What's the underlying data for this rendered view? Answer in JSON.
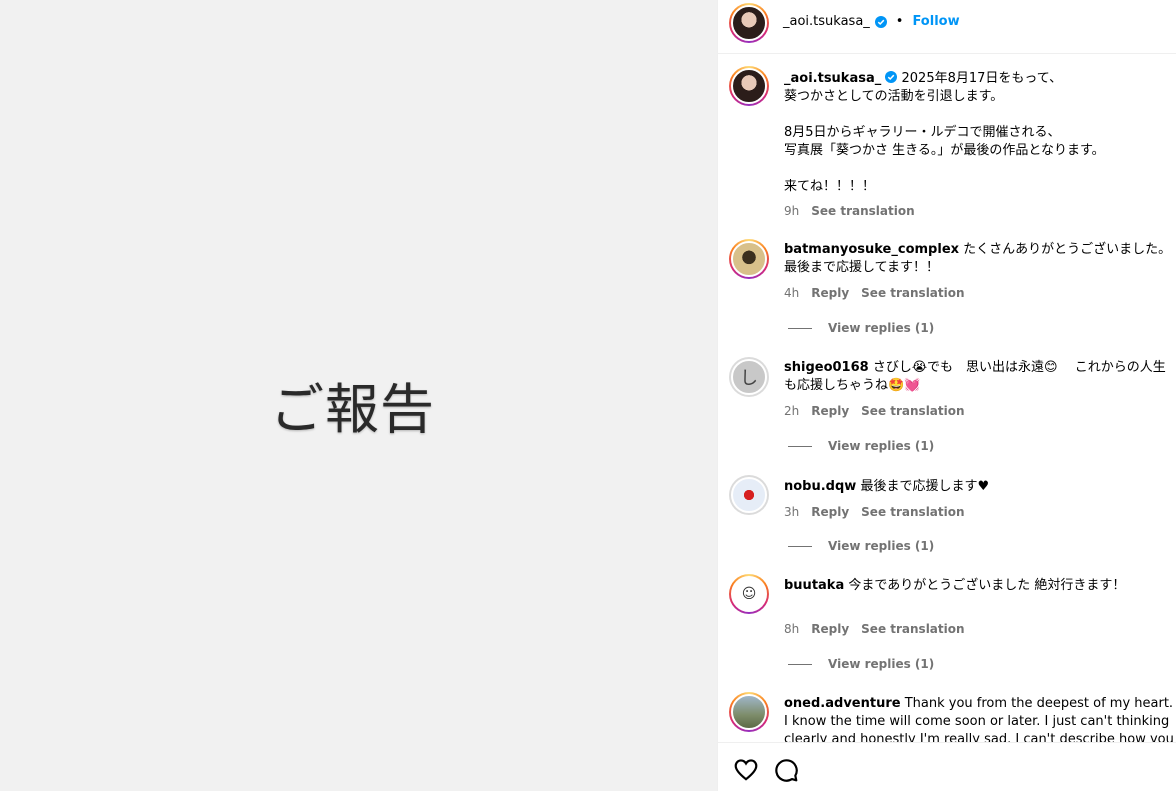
{
  "media": {
    "text": "ご報告",
    "background": "#f1f1f1"
  },
  "header": {
    "username": "_aoi.tsukasa_",
    "verified": true,
    "separator": "•",
    "follow_label": "Follow",
    "follow_color": "#0095f6"
  },
  "caption": {
    "username": "_aoi.tsukasa_",
    "lines": [
      "2025年8月17日をもって、",
      "葵つかさとしての活動を引退します。",
      "",
      "8月5日からギャラリー・ルデコで開催される、",
      "写真展「葵つかさ 生きる。」が最後の作品となります。",
      "",
      "来てね！！！！"
    ],
    "time": "9h",
    "see_translation": "See translation"
  },
  "comments": [
    {
      "username": "batmanyosuke_complex",
      "text": "たくさんありがとうございました。最後まで応援してます！！",
      "time": "4h",
      "reply": "Reply",
      "see_translation": "See translation",
      "view_replies": "View replies (1)",
      "avatar_icon": "batman-avatar"
    },
    {
      "username": "shigeo0168",
      "text": "さびし😭でも　思い出は永遠😊　 これからの人生も応援しちゃうね🤩💓",
      "time": "2h",
      "reply": "Reply",
      "see_translation": "See translation",
      "view_replies": "View replies (1)",
      "avatar_icon": "letter-shi-avatar"
    },
    {
      "username": "nobu.dqw",
      "text": "最後まで応援します♥",
      "time": "3h",
      "reply": "Reply",
      "see_translation": "See translation",
      "view_replies": "View replies (1)",
      "avatar_icon": "japan-flag-avatar"
    },
    {
      "username": "buutaka",
      "text": "今までありがとうございました 絶対行きます！",
      "time": "8h",
      "reply": "Reply",
      "see_translation": "See translation",
      "view_replies": "View replies (1)",
      "avatar_icon": "sketch-face-avatar"
    },
    {
      "username": "oned.adventure",
      "text": "Thank you from the deepest of my heart. I know the time will come soon or later. I just can't thinking clearly and honestly I'm really sad. I can't describe how you and",
      "avatar_icon": "outdoor-photo-avatar"
    }
  ],
  "footer": {
    "like_icon": "heart-icon",
    "comment_icon": "comment-icon"
  }
}
